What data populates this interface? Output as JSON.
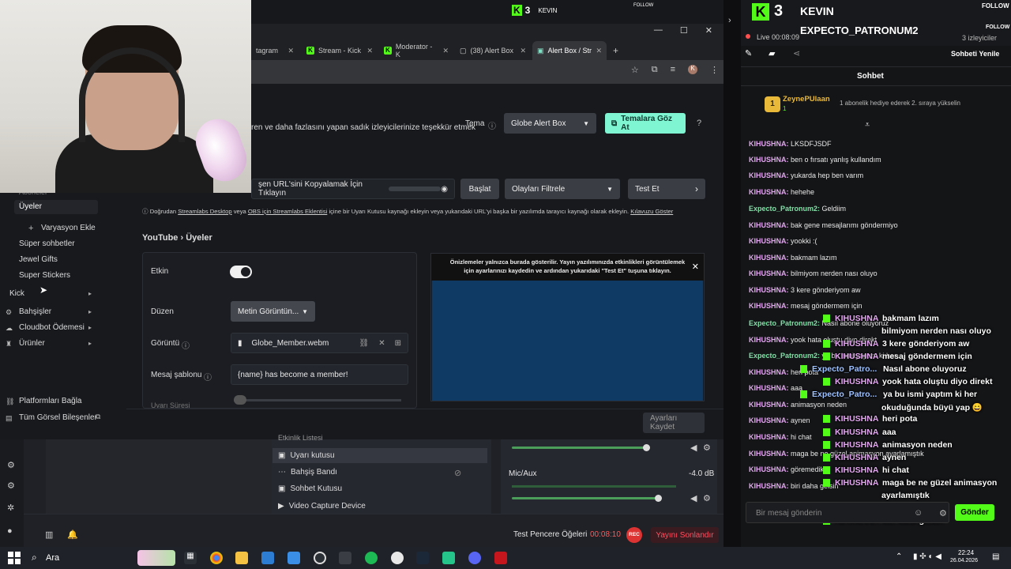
{
  "overlay": {
    "kick_logo": "3",
    "streamer_name": "KEVIN",
    "follow_label": "FOLLOW",
    "watcher": "EXPECTO_PATRONUM2"
  },
  "browser": {
    "mini_logo": "3",
    "mini_name": "KEVIN",
    "mini_follow": "FOLLOW",
    "tabs": [
      {
        "label": "tagram"
      },
      {
        "label": "Stream - Kick"
      },
      {
        "label": "Moderator - K"
      },
      {
        "label": "(38) Alert Box"
      },
      {
        "label": "Alert Box / Str"
      }
    ]
  },
  "page": {
    "description": "ren ve daha fazlasını yapan sadık izleyicilerinize teşekkür etmek",
    "theme_label": "Tema",
    "theme_value": "Globe Alert Box",
    "browse_themes": "Temalara Göz At",
    "url_copy": "şen URL'sini Kopyalamak İçin Tıklayın",
    "start_button": "Başlat",
    "filter_value": "Olayları Filtrele",
    "test_button": "Test Et",
    "info_prefix": "Doğrudan",
    "info_link1": "Streamlabs Desktop",
    "info_mid1": "veya",
    "info_link2": "OBS için Streamlabs Eklentisi",
    "info_mid2": "içine bir Uyarı Kutusu kaynağı ekleyin veya yukarıdaki URL'yi başka bir yazılımda tarayıcı kaynağı olarak ekleyin.",
    "info_link3": "Kılavuzu Göster",
    "section_title": "YouTube › Üyeler",
    "enabled_label": "Etkin",
    "layout_label": "Düzen",
    "layout_value": "Metin Görüntün...",
    "image_label": "Görüntü",
    "image_value": "Globe_Member.webm",
    "template_label": "Mesaj şablonu",
    "template_value": "{name} has become a member!",
    "cutoff_label": "Uyarı Süresi",
    "preview_notice": "Önizlemeler yalnızca burada gösterilir. Yayın yazılımınızda etkinlikleri görüntülemek için ayarlarınızı kaydedin ve ardından yukarıdaki \"Test Et\" tuşuna tıklayın.",
    "save_button": "Ayarları Kaydet"
  },
  "sidebar": {
    "top_cut": "Aboneler",
    "selected": "Üyeler",
    "add_variation": "Varyasyon Ekle",
    "items": [
      "Süper sohbetler",
      "Jewel Gifts",
      "Super Stickers"
    ],
    "kick": "Kick",
    "groups": [
      "Bahşişler",
      "Cloudbot Ödemesi",
      "Ürünler"
    ],
    "connect": "Platformları Bağla",
    "all_widgets": "Tüm Görsel Bileşenler"
  },
  "obs": {
    "sources_cut": "Etkinlik Listesi",
    "sources": [
      "Uyarı kutusu",
      "Bahşiş Bandı",
      "Sohbet Kutusu",
      "Video Capture Device"
    ],
    "mixer_label": "Mic/Aux",
    "mixer_db": "-4.0 dB",
    "test_windows": "Test Pencere Öğeleri",
    "timer": "00:08:10",
    "rec": "REC",
    "end_stream": "Yayını Sonlandır"
  },
  "chat": {
    "live_label": "Live 00:08:09",
    "viewers": "3 izleyiciler",
    "refresh": "Sohbeti Yenile",
    "title": "Sohbet",
    "leader_name": "ZeynePUlaan",
    "leader_rank": "1",
    "leader_sub_count": "1",
    "leader_note": "1 abonelik hediye ederek 2. sıraya yükselin",
    "messages": [
      {
        "user": "KIHUSHNA",
        "text": "LKSDFJSDF",
        "color": "pink"
      },
      {
        "user": "KIHUSHNA",
        "text": "ben o fırsatı yanlış kullandım",
        "color": "pink"
      },
      {
        "user": "KIHUSHNA",
        "text": "yukarda hep ben varım",
        "color": "pink"
      },
      {
        "user": "KIHUSHNA",
        "text": "hehehe",
        "color": "pink"
      },
      {
        "user": "Expecto_Patronum2",
        "text": "Geldiim",
        "color": "green"
      },
      {
        "user": "KIHUSHNA",
        "text": "bak gene mesajlarımı göndermiyo",
        "color": "pink"
      },
      {
        "user": "KIHUSHNA",
        "text": "yookki :(",
        "color": "pink"
      },
      {
        "user": "KIHUSHNA",
        "text": "bakmam lazım",
        "color": "pink"
      },
      {
        "user": "KIHUSHNA",
        "text": "bilmiyom nerden nası oluyo",
        "color": "pink"
      },
      {
        "user": "KIHUSHNA",
        "text": "3 kere gönderiyom aw",
        "color": "pink"
      },
      {
        "user": "KIHUSHNA",
        "text": "mesaj göndermem için",
        "color": "pink"
      },
      {
        "user": "Expecto_Patronum2",
        "text": "Nasıl abone oluyoruz",
        "color": "green"
      },
      {
        "user": "KIHUSHNA",
        "text": "yook hata oluştu diyo direkt",
        "color": "pink"
      },
      {
        "user": "Expecto_Patronum2",
        "text": "ya bu ismi yaptım ki her",
        "color": "green"
      },
      {
        "user": "KIHUSHNA",
        "text": "heri pota",
        "color": "pink"
      },
      {
        "user": "KIHUSHNA",
        "text": "aaa",
        "color": "pink"
      },
      {
        "user": "KIHUSHNA",
        "text": "animasyon neden",
        "color": "pink"
      },
      {
        "user": "KIHUSHNA",
        "text": "aynen",
        "color": "pink"
      },
      {
        "user": "KIHUSHNA",
        "text": "hi chat",
        "color": "pink"
      },
      {
        "user": "KIHUSHNA",
        "text": "maga be ne güzel animasyon ayarlamıştık",
        "color": "pink"
      },
      {
        "user": "KIHUSHNA",
        "text": "göremedik",
        "color": "pink"
      },
      {
        "user": "KIHUSHNA",
        "text": "biri daha gelsin",
        "color": "pink"
      }
    ],
    "input_placeholder": "Bir mesaj gönderin",
    "send": "Gönder"
  },
  "overlay_chat": [
    {
      "user": "KIHUSHNA",
      "text": "bakmam lazım"
    },
    {
      "user": "",
      "text": "bilmiyom nerden nası oluyo"
    },
    {
      "user": "KIHUSHNA",
      "text": "3 kere gönderiyom aw"
    },
    {
      "user": "KIHUSHNA",
      "text": "mesaj göndermem için"
    },
    {
      "user": "Expecto_Patro...",
      "text": "Nasıl abone oluyoruz"
    },
    {
      "user": "KIHUSHNA",
      "text": "yook hata oluştu diyo direkt"
    },
    {
      "user": "Expecto_Patro...",
      "text": "ya bu ismi yaptım ki her"
    },
    {
      "user": "",
      "text": "okuduğunda büyü yap 😄"
    },
    {
      "user": "KIHUSHNA",
      "text": "heri pota"
    },
    {
      "user": "KIHUSHNA",
      "text": "aaa"
    },
    {
      "user": "KIHUSHNA",
      "text": "animasyon neden"
    },
    {
      "user": "KIHUSHNA",
      "text": "aynen"
    },
    {
      "user": "KIHUSHNA",
      "text": "hi chat"
    },
    {
      "user": "KIHUSHNA",
      "text": "maga be ne güzel animasyon"
    },
    {
      "user": "",
      "text": "ayarlamıştık"
    },
    {
      "user": "KIHUSHNA",
      "text": "göremedik"
    },
    {
      "user": "KIHUSHNA",
      "text": "biri daha gelsin"
    }
  ],
  "taskbar": {
    "search": "Ara",
    "time": "22:24",
    "date": "26.04.2026"
  },
  "colors": {
    "kick_green": "#53fc18",
    "teal_button": "#80f5d2",
    "end_red": "#ff4f61",
    "send_green": "#53fc18"
  }
}
